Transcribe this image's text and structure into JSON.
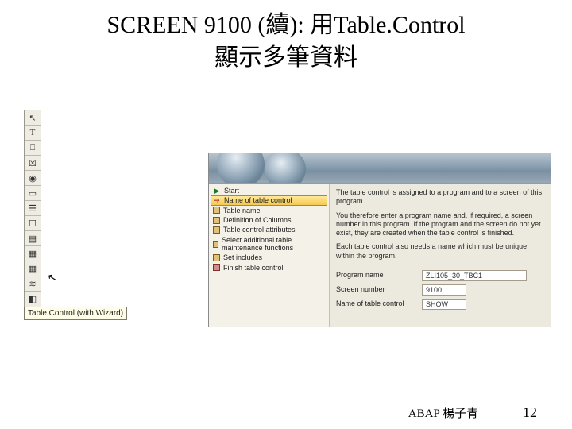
{
  "title": {
    "line1_a": "SCREEN 9100 (",
    "line1_b": "續",
    "line1_c": "): ",
    "line1_d": "用",
    "line1_e": "Table.Control",
    "line2": "顯示多筆資料"
  },
  "toolbox": {
    "items": [
      {
        "name": "pointer-icon",
        "glyph": "↖"
      },
      {
        "name": "text-icon",
        "glyph": "T"
      },
      {
        "name": "input-icon",
        "glyph": "⎕"
      },
      {
        "name": "checkbox-icon",
        "glyph": "☒"
      },
      {
        "name": "radio-icon",
        "glyph": "◉"
      },
      {
        "name": "button-icon",
        "glyph": "▭"
      },
      {
        "name": "tabstrip-icon",
        "glyph": "☰"
      },
      {
        "name": "box-icon",
        "glyph": "☐"
      },
      {
        "name": "subscreen-icon",
        "glyph": "▤"
      },
      {
        "name": "table-control-icon",
        "glyph": "▦"
      },
      {
        "name": "table-control-wizard-icon",
        "glyph": "▦"
      },
      {
        "name": "custom-control-icon",
        "glyph": "≋"
      },
      {
        "name": "status-icon",
        "glyph": "◧"
      }
    ]
  },
  "tooltip": "Table Control (with Wizard)",
  "wizard": {
    "nav": [
      {
        "icon": "play",
        "label": "Start",
        "selected": false
      },
      {
        "icon": "arrow",
        "label": "Name of table control",
        "selected": true
      },
      {
        "icon": "box",
        "label": "Table name",
        "selected": false
      },
      {
        "icon": "box",
        "label": "Definition of Columns",
        "selected": false
      },
      {
        "icon": "box",
        "label": "Table control attributes",
        "selected": false
      },
      {
        "icon": "box",
        "label": "Select additional table maintenance functions",
        "selected": false
      },
      {
        "icon": "box",
        "label": "Set includes",
        "selected": false
      },
      {
        "icon": "boxred",
        "label": "Finish table control",
        "selected": false
      }
    ],
    "intro1": "The table control is assigned to a program and to a screen of this program.",
    "intro2": "You therefore enter a program name and, if required, a screen number in this program. If the program and the screen do not yet exist, they are created when the table control is finished.",
    "intro3": "Each table control also needs a name which must be unique within the program.",
    "fields": {
      "program_label": "Program name",
      "program_value": "ZLI105_30_TBC1",
      "screen_label": "Screen number",
      "screen_value": "9100",
      "tcname_label": "Name of table control",
      "tcname_value": "SHOW"
    }
  },
  "footer": {
    "credit": "ABAP 楊子青",
    "page": "12"
  }
}
